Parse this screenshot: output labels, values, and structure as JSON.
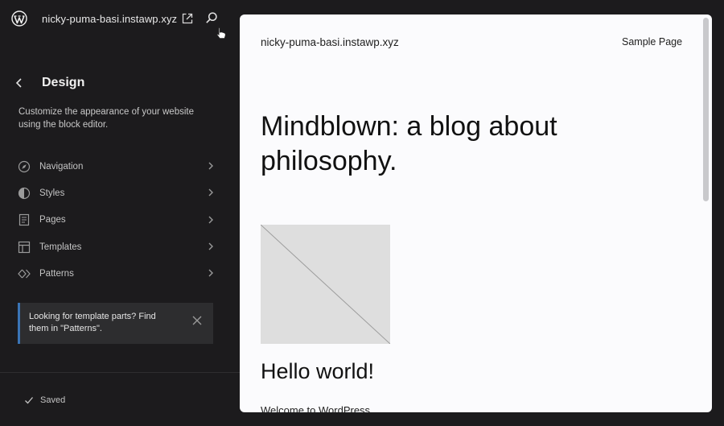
{
  "topbar": {
    "site_name": "nicky-puma-basi.instawp.xyz",
    "icons": [
      "wordpress-logo",
      "external-link-icon",
      "search-icon",
      "cursor-icon"
    ]
  },
  "sidebar": {
    "title": "Design",
    "description": "Customize the appearance of your website using the block editor.",
    "items": [
      {
        "label": "Navigation",
        "icon": "compass-icon"
      },
      {
        "label": "Styles",
        "icon": "half-circle-icon"
      },
      {
        "label": "Pages",
        "icon": "page-icon"
      },
      {
        "label": "Templates",
        "icon": "layout-icon"
      },
      {
        "label": "Patterns",
        "icon": "diamond-icon"
      }
    ],
    "notice": "Looking for template parts? Find them in \"Patterns\".",
    "saved_label": "Saved"
  },
  "preview": {
    "site_title": "nicky-puma-basi.instawp.xyz",
    "nav_link": "Sample Page",
    "heading": "Mindblown: a blog about philosophy.",
    "post_title": "Hello world!",
    "post_excerpt": "Welcome to WordPress."
  },
  "colors": {
    "sidebar_bg": "#1c1b1d",
    "notice_bg": "#2d2d2f",
    "notice_accent": "#3a74b5",
    "preview_bg": "#fbfbfd",
    "placeholder_image": "#dedede"
  }
}
